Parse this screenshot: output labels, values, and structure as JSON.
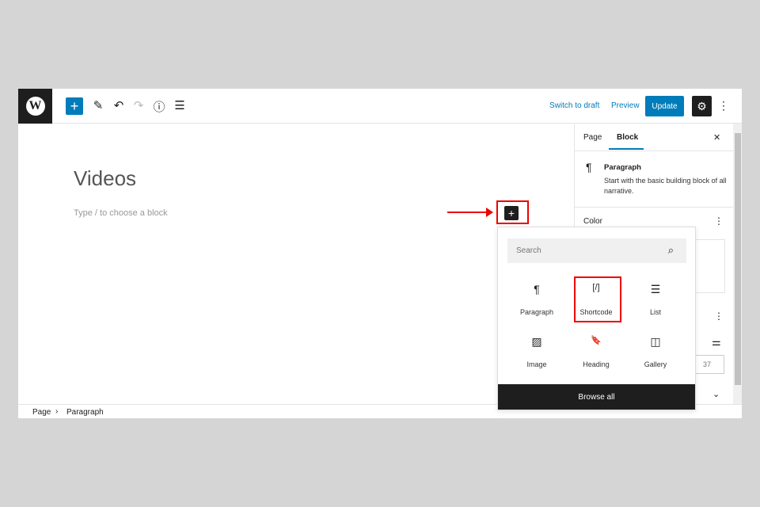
{
  "topbar": {
    "logo": "W",
    "add": "+",
    "tools": [
      "✎",
      "↶",
      "↷",
      "ⓘ",
      "☰"
    ],
    "switch_draft": "Switch to draft",
    "preview": "Preview",
    "update": "Update",
    "settings": "⚙",
    "more": "⋮"
  },
  "editor": {
    "title": "Videos",
    "placeholder": "Type / to choose a block",
    "inline_add": "+"
  },
  "sidebar": {
    "tabs": [
      "Page",
      "Block"
    ],
    "close": "✕",
    "block_icon": "¶",
    "block_name": "Paragraph",
    "block_desc": "Start with the basic building block of all narrative.",
    "color_label": "Color",
    "more": "⋮",
    "more2": "⋮",
    "settings_icon": "⚌",
    "value": "37",
    "chevron": "⌄"
  },
  "inserter": {
    "search_placeholder": "Search",
    "search_icon": "⌕",
    "blocks": [
      {
        "icon": "¶",
        "label": "Paragraph"
      },
      {
        "icon": "[/]",
        "label": "Shortcode"
      },
      {
        "icon": "☰",
        "label": "List"
      },
      {
        "icon": "▨",
        "label": "Image"
      },
      {
        "icon": "🔖",
        "label": "Heading"
      },
      {
        "icon": "◫",
        "label": "Gallery"
      }
    ],
    "browse_all": "Browse all"
  },
  "status": {
    "crumbs": [
      "Page",
      "Paragraph"
    ],
    "sep": "›"
  }
}
